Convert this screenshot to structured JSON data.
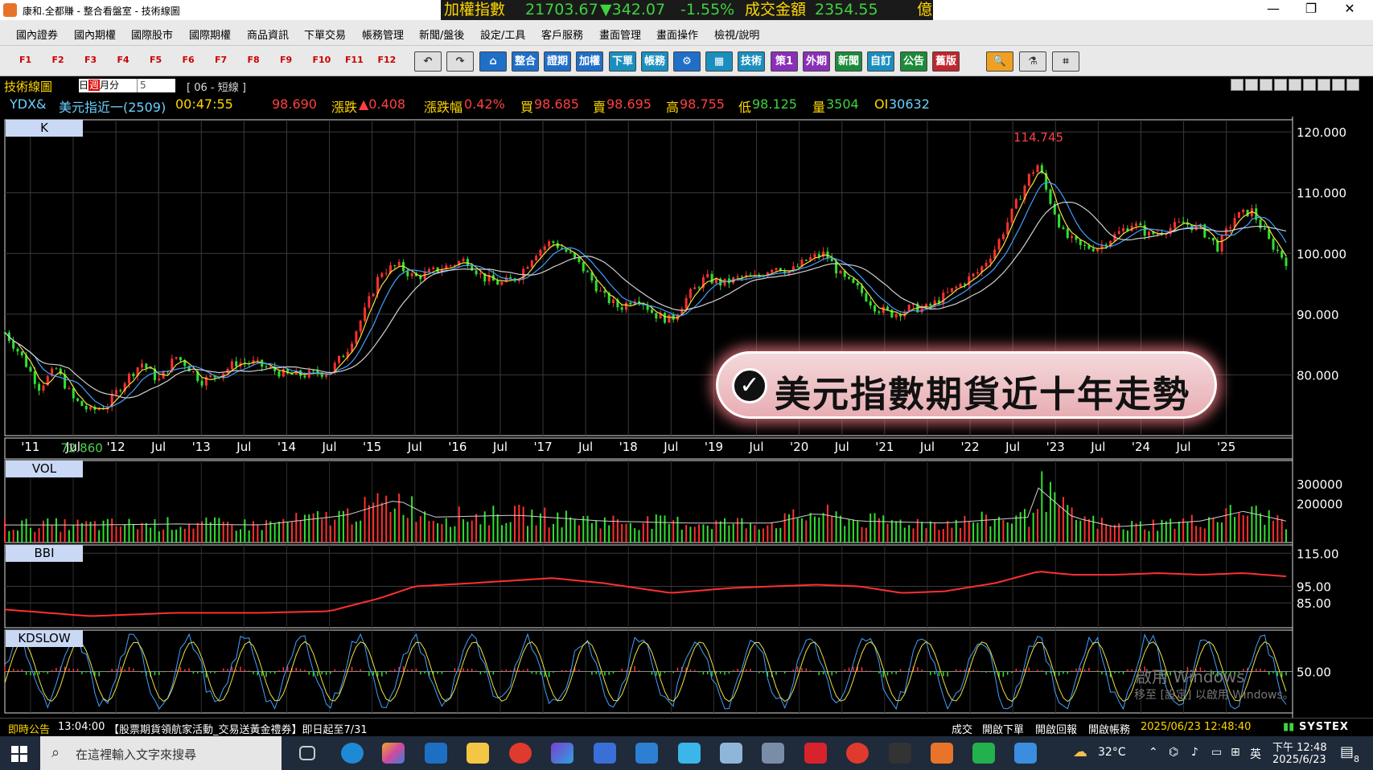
{
  "window": {
    "title": "康和.全都賺 - 整合看盤室 - 技術線圖",
    "minimize": "—",
    "restore": "❐",
    "close": "✕"
  },
  "ticker": {
    "label": "加權指數",
    "value": "21703.67",
    "change": "▼342.07",
    "pct": "-1.55%",
    "turnover_label": "成交金額",
    "turnover": "2354.55",
    "unit": "億"
  },
  "menu": [
    "國內證券",
    "國內期權",
    "國際股市",
    "國際期權",
    "商品資訊",
    "下單交易",
    "帳務管理",
    "新聞/盤後",
    "設定/工具",
    "客戶服務",
    "畫面管理",
    "畫面操作",
    "檢視/說明"
  ],
  "fkeys": [
    "F1",
    "F2",
    "F3",
    "F4",
    "F5",
    "F6",
    "F7",
    "F8",
    "F9",
    "F10",
    "F11",
    "F12"
  ],
  "toolbar_buttons": [
    {
      "label": "↶",
      "icon": "undo-icon",
      "color": "light"
    },
    {
      "label": "↷",
      "icon": "redo-icon",
      "color": "light"
    },
    {
      "label": "⌂",
      "icon": "home-icon",
      "color": "#1f6fc8"
    },
    {
      "label": "整合",
      "color": "#1f6fc8"
    },
    {
      "label": "證期",
      "color": "#1f6fc8"
    },
    {
      "label": "加權",
      "color": "#1f6fc8"
    },
    {
      "label": "下單",
      "color": "#1a8fbf"
    },
    {
      "label": "帳務",
      "color": "#1a8fbf"
    },
    {
      "label": "⚙",
      "icon": "gear-icon",
      "color": "#1f6fc8"
    },
    {
      "label": "▦",
      "icon": "chart-icon",
      "color": "#1a8fbf"
    },
    {
      "label": "技術",
      "color": "#1a8fbf"
    },
    {
      "label": "策1",
      "color": "#8a2fb8"
    },
    {
      "label": "外期",
      "color": "#8a2fb8"
    },
    {
      "label": "新聞",
      "color": "#1d8a3a"
    },
    {
      "label": "自訂",
      "color": "#1a8fbf"
    },
    {
      "label": "公告",
      "color": "#1d8a3a"
    },
    {
      "label": "舊版",
      "color": "#c0262d"
    },
    {
      "label": "🔍",
      "icon": "search-icon",
      "color": "#f0a020"
    },
    {
      "label": "⚗",
      "icon": "tools-icon",
      "color": "light"
    },
    {
      "label": "⌗",
      "icon": "crop-icon",
      "color": "light"
    }
  ],
  "chart_header": {
    "title": "技術線圖",
    "period_options": [
      "日",
      "週",
      "月",
      "分"
    ],
    "period_selected": "週",
    "minute_value": "5",
    "study": "[ 06 - 短線 ]"
  },
  "quote": {
    "symbol": "YDX&",
    "name": "美元指近一(2509)",
    "time": "00:47:55",
    "price": "98.690",
    "change_label": "漲跌",
    "change": "▲0.408",
    "change_pct_label": "漲跌幅",
    "change_pct": "0.42%",
    "bid_label": "買",
    "bid": "98.685",
    "ask_label": "賣",
    "ask": "98.695",
    "high_label": "高",
    "high": "98.755",
    "low_label": "低",
    "low": "98.125",
    "volume_label": "量",
    "volume": "3504",
    "oi_label": "OI",
    "oi": "30632"
  },
  "panels": {
    "k": "K",
    "vol": "VOL",
    "bbi": "BBI",
    "kd": "KDSLOW"
  },
  "banner": "美元指數期貨近十年走勢",
  "chart_data": [
    {
      "type": "line",
      "panel": "K",
      "title": "",
      "ylim": [
        70,
        122
      ],
      "yticks": [
        "120.000",
        "110.000",
        "100.000",
        "90.000",
        "80.000"
      ],
      "yticks_values": [
        120,
        110,
        100,
        90,
        80
      ],
      "xticks": [
        {
          "label": "'11",
          "t": 0.3
        },
        {
          "label": "Jul",
          "t": 0.8
        },
        {
          "label": "'12",
          "t": 1.3
        },
        {
          "label": "Jul",
          "t": 1.8
        },
        {
          "label": "'13",
          "t": 2.3
        },
        {
          "label": "Jul",
          "t": 2.8
        },
        {
          "label": "'14",
          "t": 3.3
        },
        {
          "label": "Jul",
          "t": 3.8
        },
        {
          "label": "'15",
          "t": 4.3
        },
        {
          "label": "Jul",
          "t": 4.8
        },
        {
          "label": "'16",
          "t": 5.3
        },
        {
          "label": "Jul",
          "t": 5.8
        },
        {
          "label": "'17",
          "t": 6.3
        },
        {
          "label": "Jul",
          "t": 6.8
        },
        {
          "label": "'18",
          "t": 7.3
        },
        {
          "label": "Jul",
          "t": 7.8
        },
        {
          "label": "'19",
          "t": 8.3
        },
        {
          "label": "Jul",
          "t": 8.8
        },
        {
          "label": "'20",
          "t": 9.3
        },
        {
          "label": "Jul",
          "t": 9.8
        },
        {
          "label": "'21",
          "t": 10.3
        },
        {
          "label": "Jul",
          "t": 10.8
        },
        {
          "label": "'22",
          "t": 11.3
        },
        {
          "label": "Jul",
          "t": 11.8
        },
        {
          "label": "'23",
          "t": 12.3
        },
        {
          "label": "Jul",
          "t": 12.8
        },
        {
          "label": "'24",
          "t": 13.3
        },
        {
          "label": "Jul",
          "t": 13.8
        },
        {
          "label": "'25",
          "t": 14.3
        }
      ],
      "t_range": [
        0,
        15.0
      ],
      "series": [
        {
          "values": [
            [
              0,
              87
            ],
            [
              0.2,
              83
            ],
            [
              0.4,
              78
            ],
            [
              0.6,
              81
            ],
            [
              0.8,
              76
            ],
            [
              1.0,
              74
            ],
            [
              1.2,
              75
            ],
            [
              1.4,
              79
            ],
            [
              1.6,
              82
            ],
            [
              1.8,
              79
            ],
            [
              2.0,
              83
            ],
            [
              2.1,
              82
            ],
            [
              2.3,
              79
            ],
            [
              2.5,
              80
            ],
            [
              2.7,
              82
            ],
            [
              2.9,
              82
            ],
            [
              3.1,
              81
            ],
            [
              3.3,
              80
            ],
            [
              3.5,
              80
            ],
            [
              3.8,
              80.5
            ],
            [
              4.0,
              84
            ],
            [
              4.2,
              90
            ],
            [
              4.4,
              97
            ],
            [
              4.6,
              98
            ],
            [
              4.8,
              96
            ],
            [
              5.0,
              97
            ],
            [
              5.2,
              98
            ],
            [
              5.4,
              99
            ],
            [
              5.6,
              96
            ],
            [
              5.8,
              95
            ],
            [
              6.0,
              96
            ],
            [
              6.2,
              100
            ],
            [
              6.4,
              102
            ],
            [
              6.6,
              100
            ],
            [
              6.8,
              97
            ],
            [
              7.0,
              93
            ],
            [
              7.2,
              91
            ],
            [
              7.4,
              93
            ],
            [
              7.6,
              90
            ],
            [
              7.8,
              89
            ],
            [
              8.0,
              93
            ],
            [
              8.2,
              96
            ],
            [
              8.4,
              95
            ],
            [
              8.6,
              96
            ],
            [
              8.8,
              96
            ],
            [
              9.0,
              98
            ],
            [
              9.2,
              97
            ],
            [
              9.4,
              99
            ],
            [
              9.6,
              100
            ],
            [
              9.8,
              96
            ],
            [
              10.0,
              94
            ],
            [
              10.2,
              91
            ],
            [
              10.4,
              90
            ],
            [
              10.6,
              91
            ],
            [
              10.8,
              91
            ],
            [
              11.0,
              93
            ],
            [
              11.2,
              95
            ],
            [
              11.4,
              97
            ],
            [
              11.6,
              101
            ],
            [
              11.8,
              107
            ],
            [
              12.0,
              113
            ],
            [
              12.1,
              114.7
            ],
            [
              12.2,
              110
            ],
            [
              12.4,
              103
            ],
            [
              12.6,
              101
            ],
            [
              12.8,
              101
            ],
            [
              13.0,
              103
            ],
            [
              13.2,
              105
            ],
            [
              13.4,
              103
            ],
            [
              13.6,
              104
            ],
            [
              13.8,
              105
            ],
            [
              14.0,
              104
            ],
            [
              14.2,
              101
            ],
            [
              14.4,
              106
            ],
            [
              14.6,
              107
            ],
            [
              14.8,
              102
            ],
            [
              15.0,
              98.7
            ]
          ]
        }
      ],
      "annotations": [
        {
          "label": "114.745",
          "t": 12.1,
          "y": 114.745,
          "color": "#ff4040"
        },
        {
          "label": "72.860",
          "t": 0.9,
          "y": 72.86,
          "color": "#4dd34d"
        }
      ]
    },
    {
      "type": "bar",
      "panel": "VOL",
      "ylim": [
        0,
        420000
      ],
      "yticks": [
        "300000",
        "200000"
      ],
      "yticks_values": [
        300000,
        200000
      ],
      "series": [
        {
          "values": [
            [
              0,
              90000
            ],
            [
              1,
              90000
            ],
            [
              2,
              95000
            ],
            [
              3,
              90000
            ],
            [
              4,
              140000
            ],
            [
              4.6,
              220000
            ],
            [
              5,
              130000
            ],
            [
              6,
              140000
            ],
            [
              7,
              110000
            ],
            [
              8,
              100000
            ],
            [
              9,
              100000
            ],
            [
              9.5,
              150000
            ],
            [
              10,
              110000
            ],
            [
              11,
              100000
            ],
            [
              12,
              130000
            ],
            [
              12.1,
              280000
            ],
            [
              12.5,
              130000
            ],
            [
              13,
              80000
            ],
            [
              14,
              110000
            ],
            [
              14.5,
              160000
            ],
            [
              15,
              110000
            ]
          ]
        }
      ]
    },
    {
      "type": "line",
      "panel": "BBI",
      "ylim": [
        70,
        120
      ],
      "yticks": [
        "115.00",
        "95.00",
        "85.00"
      ],
      "yticks_values": [
        115,
        95,
        85
      ],
      "series": [
        {
          "values": [
            [
              0,
              81
            ],
            [
              1,
              77
            ],
            [
              2,
              79
            ],
            [
              3,
              79
            ],
            [
              3.8,
              80
            ],
            [
              4.4,
              88
            ],
            [
              4.8,
              95
            ],
            [
              5.5,
              97
            ],
            [
              6.4,
              100
            ],
            [
              7.0,
              97
            ],
            [
              7.8,
              91
            ],
            [
              8.5,
              94
            ],
            [
              9.5,
              96
            ],
            [
              10.0,
              95
            ],
            [
              10.5,
              91
            ],
            [
              11.0,
              92
            ],
            [
              11.6,
              97
            ],
            [
              12.1,
              104
            ],
            [
              12.5,
              102
            ],
            [
              13,
              102
            ],
            [
              13.5,
              103
            ],
            [
              14,
              102
            ],
            [
              14.5,
              103
            ],
            [
              15,
              101
            ]
          ]
        }
      ]
    },
    {
      "type": "line",
      "panel": "KDSLOW",
      "ylim": [
        0,
        100
      ],
      "yticks": [
        "50.00"
      ],
      "yticks_values": [
        50
      ],
      "reference": 50
    }
  ],
  "status": {
    "announce_label": "即時公告",
    "announce_time": "13:04:00",
    "announce_text": "【股票期貨領航家活動_交易送黃金禮券】即日起至7/31",
    "links": [
      "成交",
      "開啟下單",
      "開啟回報",
      "開啟帳務"
    ],
    "datetime": "2025/06/23 12:48:40",
    "brand": "SYSTEX"
  },
  "taskbar": {
    "search_placeholder": "在這裡輸入文字來搜尋",
    "weather": "32°C",
    "ime": "英",
    "time": "下午 12:48",
    "date": "2025/6/23",
    "notif_count": "8"
  },
  "watermark": {
    "line1": "啟用 Windows",
    "line2": "移至 [設定] 以啟用 Windows。"
  }
}
